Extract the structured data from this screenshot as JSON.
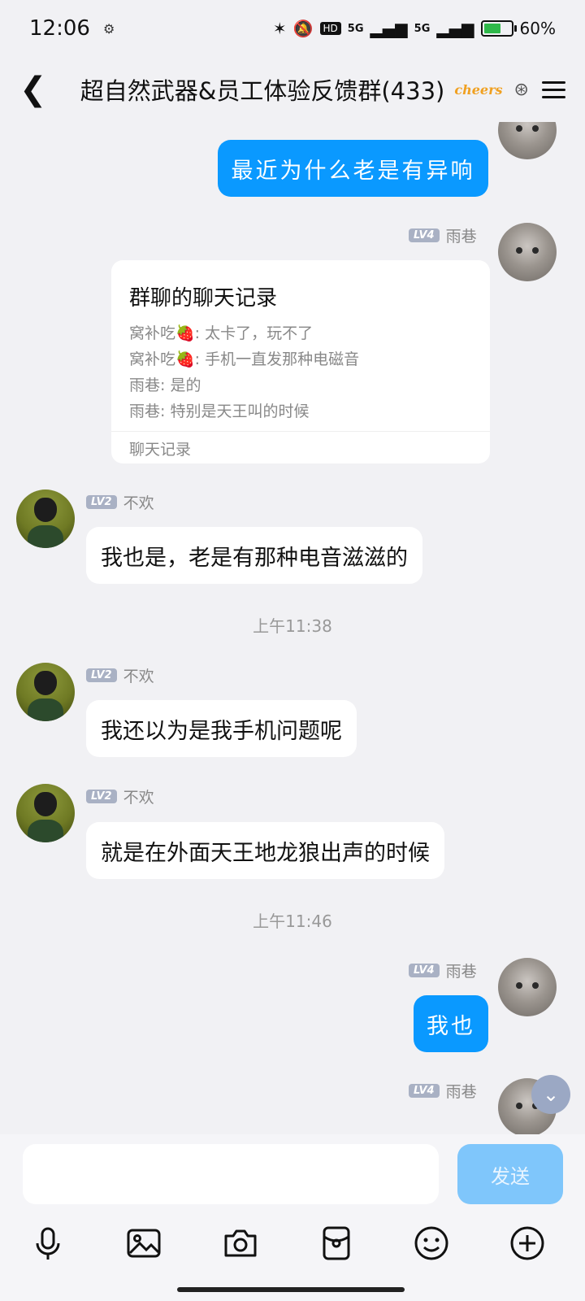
{
  "status_bar": {
    "time": "12:06",
    "net_a": "5G",
    "net_b": "5G",
    "hd_tag": "HD",
    "battery": "60%"
  },
  "header": {
    "title": "超自然武器&员工体验反馈群(433)",
    "badge": "cheers"
  },
  "messages": {
    "m1": {
      "text": "最近为什么老是有异响"
    },
    "m2": {
      "level": "LV4",
      "sender": "雨巷",
      "card_title": "群聊的聊天记录",
      "lines": [
        "窝补吃🍓: 太卡了，玩不了",
        "窝补吃🍓: 手机一直发那种电磁音",
        "雨巷: 是的",
        "雨巷: 特别是天王叫的时候"
      ],
      "card_footer": "聊天记录"
    },
    "m3": {
      "level": "LV2",
      "sender": "不欢",
      "text": "我也是，老是有那种电音滋滋的"
    },
    "time1": "上午11:38",
    "m4": {
      "level": "LV2",
      "sender": "不欢",
      "text": "我还以为是我手机问题呢"
    },
    "m5": {
      "level": "LV2",
      "sender": "不欢",
      "text": "就是在外面天王地龙狼出声的时候"
    },
    "time2": "上午11:46",
    "m6": {
      "level": "LV4",
      "sender": "雨巷",
      "text": "我也"
    },
    "m7": {
      "level": "LV4",
      "sender": "雨巷"
    }
  },
  "input": {
    "value": "",
    "send_label": "发送"
  },
  "toolbar": [
    "microphone-icon",
    "image-icon",
    "camera-icon",
    "red-packet-icon",
    "emoji-icon",
    "plus-icon"
  ]
}
